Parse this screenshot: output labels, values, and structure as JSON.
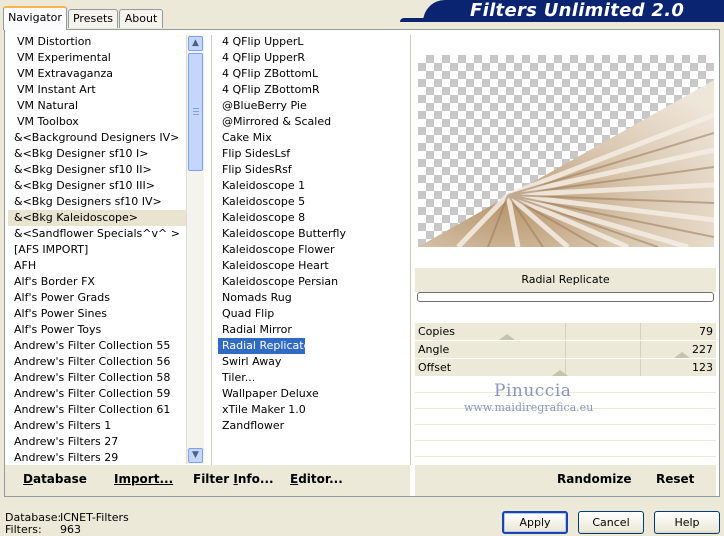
{
  "tabs": [
    "Navigator",
    "Presets",
    "About"
  ],
  "header_title": "Filters Unlimited 2.0",
  "categories": [
    "VM Distortion",
    "VM Experimental",
    "VM Extravaganza",
    "VM Instant Art",
    "VM Natural",
    "VM Toolbox",
    "&<Background Designers IV>",
    "&<Bkg Designer sf10 I>",
    "&<Bkg Designer sf10 II>",
    "&<Bkg Designer sf10 III>",
    "&<Bkg Designers sf10 IV>",
    "&<Bkg Kaleidoscope>",
    "&<Sandflower Specials^v^ >",
    "[AFS IMPORT]",
    "AFH",
    "Alf's Border FX",
    "Alf's Power Grads",
    "Alf's Power Sines",
    "Alf's Power Toys",
    "Andrew's Filter Collection 55",
    "Andrew's Filter Collection 56",
    "Andrew's Filter Collection 58",
    "Andrew's Filter Collection 59",
    "Andrew's Filter Collection 61",
    "Andrew's Filters 1",
    "Andrew's Filters 27",
    "Andrew's Filters 29"
  ],
  "filters": [
    "4 QFlip UpperL",
    "4 QFlip UpperR",
    "4 QFlip ZBottomL",
    "4 QFlip ZBottomR",
    "@BlueBerry Pie",
    "@Mirrored & Scaled",
    "Cake Mix",
    "Flip SidesLsf",
    "Flip SidesRsf",
    "Kaleidoscope 1",
    "Kaleidoscope 5",
    "Kaleidoscope 8",
    "Kaleidoscope Butterfly",
    "Kaleidoscope Flower",
    "Kaleidoscope Heart",
    "Kaleidoscope Persian",
    "Nomads Rug",
    "Quad Flip",
    "Radial Mirror",
    "Radial Replicate",
    "Swirl Away",
    "Tiler...",
    "Wallpaper Deluxe",
    "xTile Maker 1.0",
    "Zandflower"
  ],
  "selected_category": "&<Bkg Kaleidoscope>",
  "selected_filter": "Radial Replicate",
  "selected_filter_name": "Radial Replicate",
  "parameters": [
    {
      "label": "Copies",
      "value": "79"
    },
    {
      "label": "Angle",
      "value": "227"
    },
    {
      "label": "Offset",
      "value": "123"
    }
  ],
  "watermark": {
    "name": "Pinuccia",
    "url": "www.maidiregrafica.eu"
  },
  "left_buttons": {
    "database": {
      "ul": "D",
      "rest": "atabase"
    },
    "import": {
      "ul": "Import...",
      "rest": ""
    },
    "filter_info": {
      "pre": "Filter ",
      "ul": "I",
      "rest": "nfo..."
    },
    "editor": {
      "ul": "E",
      "rest": "ditor..."
    }
  },
  "right_buttons": {
    "randomize": "Randomize",
    "reset": "Reset"
  },
  "footer": {
    "database_label": "Database:",
    "database_value": "ICNET-Filters",
    "filters_label": "Filters:",
    "filters_value": "963"
  },
  "dialog_buttons": {
    "apply": "Apply",
    "cancel": "Cancel",
    "help": "Help"
  },
  "colors": {
    "header": "#0a2472",
    "selection": "#316ac5",
    "dialog_bg": "#ece9d8",
    "preview_ray": "#c0a888"
  }
}
